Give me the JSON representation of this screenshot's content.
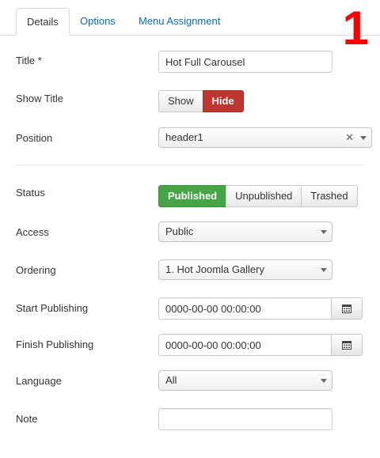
{
  "tabs": [
    {
      "label": "Details"
    },
    {
      "label": "Options"
    },
    {
      "label": "Menu Assignment"
    }
  ],
  "step_number": "1",
  "fields": {
    "title": {
      "label": "Title *",
      "value": "Hot Full Carousel"
    },
    "show_title": {
      "label": "Show Title",
      "options": [
        "Show",
        "Hide"
      ],
      "selected": "Hide"
    },
    "position": {
      "label": "Position",
      "value": "header1"
    },
    "status": {
      "label": "Status",
      "options": [
        "Published",
        "Unpublished",
        "Trashed"
      ],
      "selected": "Published"
    },
    "access": {
      "label": "Access",
      "value": "Public"
    },
    "ordering": {
      "label": "Ordering",
      "value": "1. Hot Joomla Gallery"
    },
    "start_publishing": {
      "label": "Start Publishing",
      "value": "0000-00-00 00:00:00"
    },
    "finish_publishing": {
      "label": "Finish Publishing",
      "value": "0000-00-00 00:00:00"
    },
    "language": {
      "label": "Language",
      "value": "All"
    },
    "note": {
      "label": "Note",
      "value": ""
    }
  },
  "icons": {
    "calendar": "calendar-icon",
    "caret": "chevron-down-icon",
    "clear": "clear-icon"
  },
  "colors": {
    "accent_link": "#0f6bb0",
    "hide_active": "#bd362f",
    "published_active": "#46a546",
    "step_number": "#ff0000"
  }
}
